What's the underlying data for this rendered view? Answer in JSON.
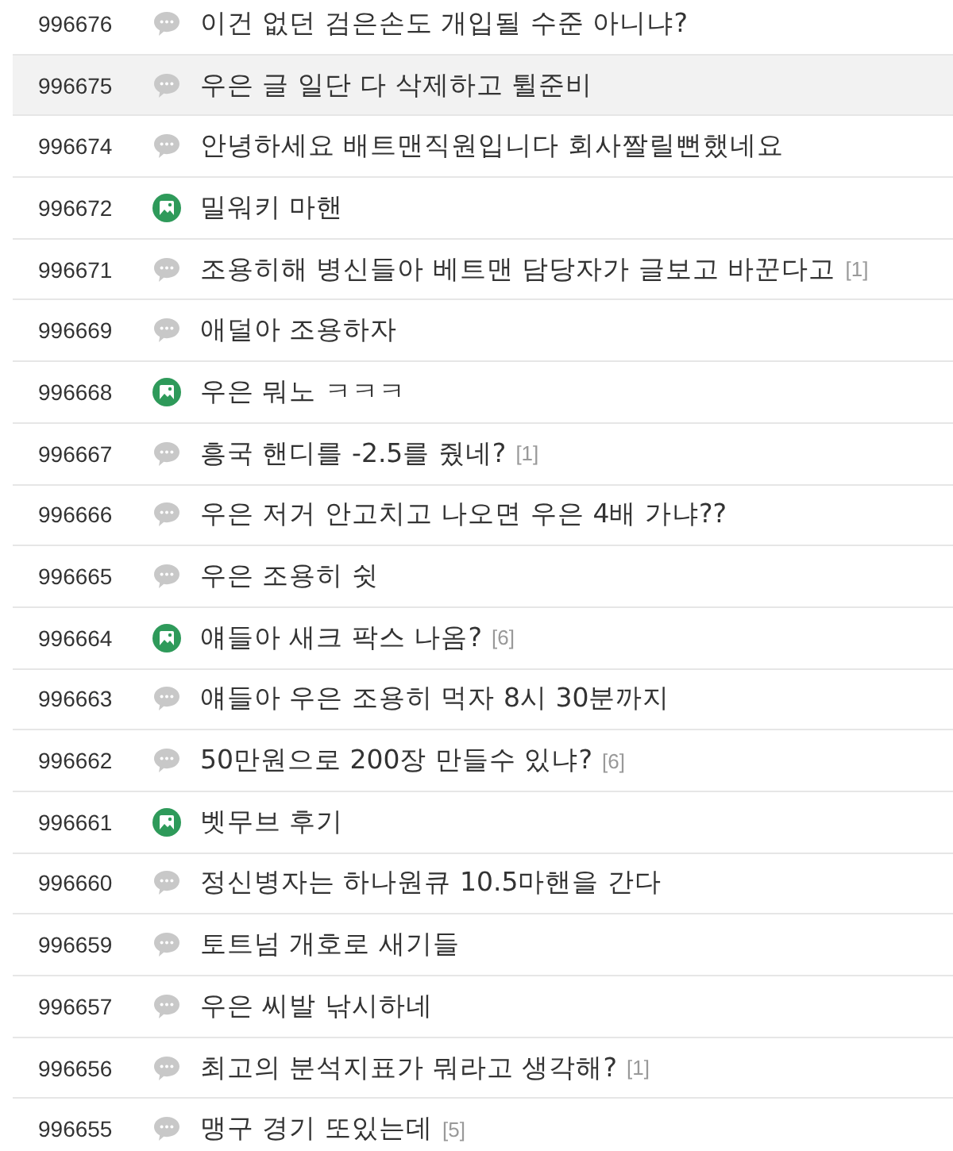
{
  "posts": [
    {
      "number": "996676",
      "kind": "text",
      "title": "이건 없던 검은손도 개입될 수준 아니냐?",
      "selected": false
    },
    {
      "number": "996675",
      "kind": "text",
      "title": "우은 글 일단 다 삭제하고 튈준비",
      "selected": true
    },
    {
      "number": "996674",
      "kind": "text",
      "title": "안녕하세요 배트맨직원입니다 회사짤릴뻔했네요",
      "selected": false
    },
    {
      "number": "996672",
      "kind": "image",
      "title": "밀워키 마핸",
      "selected": false
    },
    {
      "number": "996671",
      "kind": "text",
      "title": "조용히해 병신들아 베트맨 담당자가 글보고 바꾼다고",
      "comments": "[1]",
      "selected": false
    },
    {
      "number": "996669",
      "kind": "text",
      "title": "애덜아 조용하자",
      "selected": false
    },
    {
      "number": "996668",
      "kind": "image",
      "title": "우은 뭐노 ㅋㅋㅋ",
      "selected": false
    },
    {
      "number": "996667",
      "kind": "text",
      "title": "흥국 핸디를 -2.5를 줬네?",
      "comments": "[1]",
      "selected": false
    },
    {
      "number": "996666",
      "kind": "text",
      "title": "우은 저거 안고치고 나오면 우은 4배 가냐??",
      "selected": false
    },
    {
      "number": "996665",
      "kind": "text",
      "title": "우은 조용히 쉿",
      "selected": false
    },
    {
      "number": "996664",
      "kind": "image",
      "title": "얘들아 새크 팍스 나옴?",
      "comments": "[6]",
      "selected": false
    },
    {
      "number": "996663",
      "kind": "text",
      "title": "얘들아 우은 조용히 먹자 8시 30분까지",
      "selected": false
    },
    {
      "number": "996662",
      "kind": "text",
      "title": "50만원으로 200장 만들수 있냐?",
      "comments": "[6]",
      "selected": false
    },
    {
      "number": "996661",
      "kind": "image",
      "title": "벳무브 후기",
      "selected": false
    },
    {
      "number": "996660",
      "kind": "text",
      "title": "정신병자는 하나원큐 10.5마핸을 간다",
      "selected": false
    },
    {
      "number": "996659",
      "kind": "text",
      "title": "토트넘 개호로 새기들",
      "selected": false
    },
    {
      "number": "996657",
      "kind": "text",
      "title": "우은 씨발 낚시하네",
      "selected": false
    },
    {
      "number": "996656",
      "kind": "text",
      "title": "최고의 분석지표가 뭐라고 생각해?",
      "comments": "[1]",
      "selected": false
    },
    {
      "number": "996655",
      "kind": "text",
      "title": "맹구 경기 또있는데",
      "comments": "[5]",
      "selected": false
    }
  ]
}
